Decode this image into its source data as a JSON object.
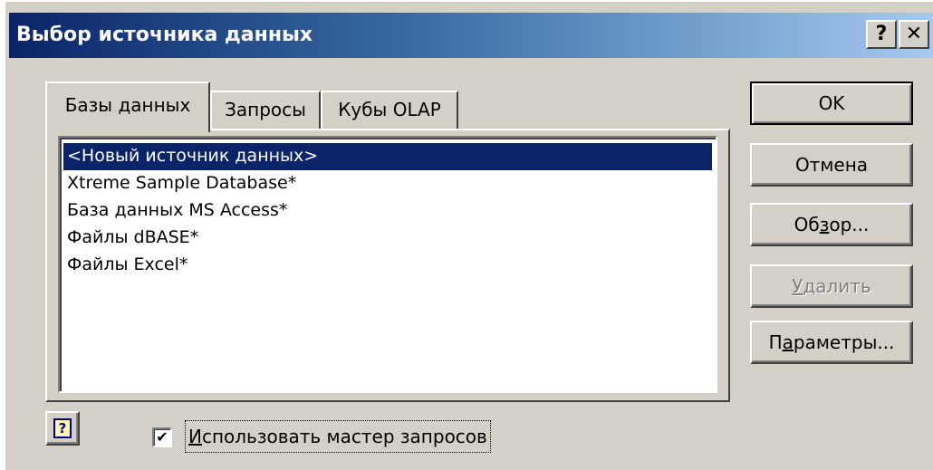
{
  "window": {
    "title": "Выбор источника данных",
    "help_button": "?",
    "close_button": "✕"
  },
  "tabs": [
    {
      "label": "Базы данных",
      "active": true
    },
    {
      "label": "Запросы",
      "active": false
    },
    {
      "label": "Кубы OLAP",
      "active": false
    }
  ],
  "list": {
    "items": [
      "<Новый источник данных>",
      "Xtreme Sample Database*",
      "База данных MS Access*",
      "Файлы dBASE*",
      "Файлы Excel*"
    ],
    "selected_index": 0
  },
  "buttons": {
    "ok": "OK",
    "cancel": "Отмена",
    "browse_prefix": "Об",
    "browse_accel": "з",
    "browse_suffix": "ор...",
    "delete_accel": "У",
    "delete_suffix": "далить",
    "params_prefix": "П",
    "params_accel": "а",
    "params_suffix": "раметры..."
  },
  "footer": {
    "help_icon": "?",
    "checkbox_checked": "✔",
    "checkbox_accel": "И",
    "checkbox_label_rest": "спользовать мастер запросов"
  },
  "colors": {
    "face": "#d4d0c8",
    "title_start": "#0a246a",
    "title_end": "#a6caf0",
    "selection": "#0a246a"
  }
}
